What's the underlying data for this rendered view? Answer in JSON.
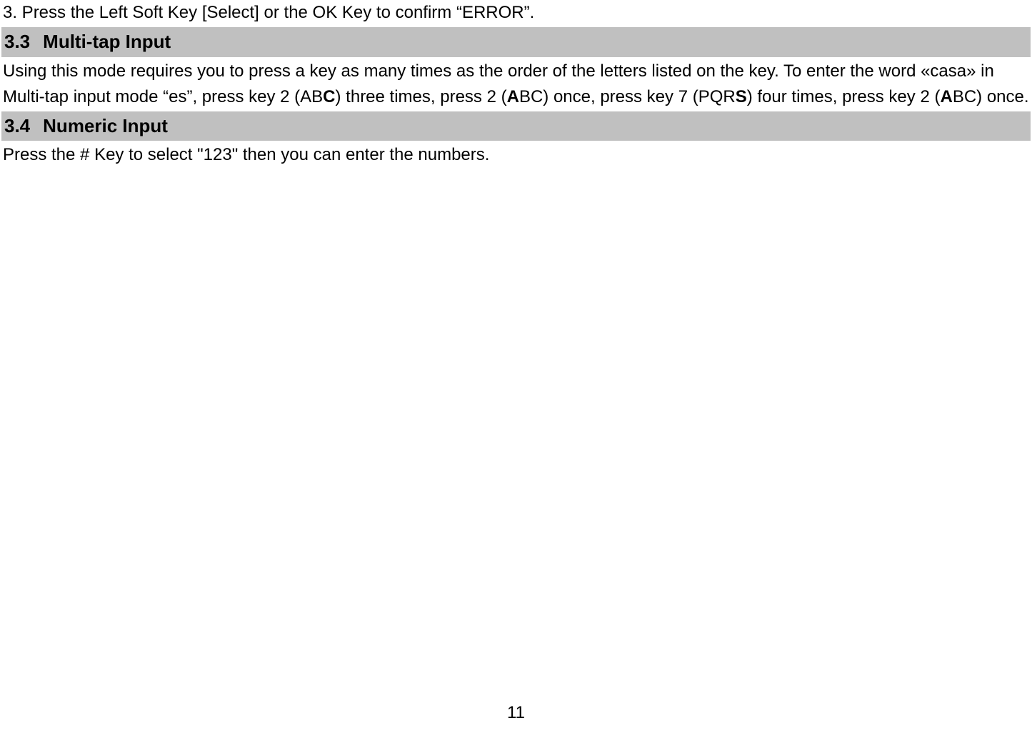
{
  "line1": "3. Press the Left Soft Key [Select] or the OK Key to confirm “ERROR”.",
  "section33": {
    "num": "3.3",
    "title": "Multi-tap Input"
  },
  "para33_pre1": "Using this mode requires you to press a key as many times as the order of the letters listed on the key. To enter the word «casa» in Multi-tap input mode “es”, press key 2 (AB",
  "para33_b1": "C",
  "para33_mid1": ") three times, press 2 (",
  "para33_b2": "A",
  "para33_mid2": "BC) once, press key 7 (PQR",
  "para33_b3": "S",
  "para33_mid3": ") four times, press key 2 (",
  "para33_b4": "A",
  "para33_end": "BC) once.",
  "section34": {
    "num": "3.4",
    "title": "Numeric Input"
  },
  "para34": "Press the # Key to select \"123\" then you can enter the numbers.",
  "pageNumber": "11"
}
